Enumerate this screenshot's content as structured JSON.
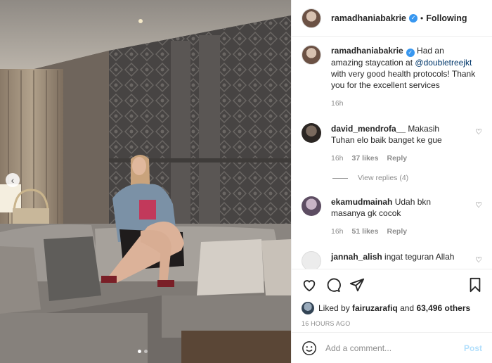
{
  "photo": {
    "alt_icon": "chevron-left-icon",
    "carousel_dots": 2,
    "active_dot": 0
  },
  "header": {
    "username": "ramadhaniabakrie",
    "separator": "•",
    "follow_status": "Following"
  },
  "caption": {
    "username": "ramadhaniabakrie",
    "text_before": " Had an amazing staycation at ",
    "mention": "@doubletreejkt",
    "text_after": " with very good health protocols! Thank you for the excellent services",
    "time": "16h"
  },
  "comments": [
    {
      "username": "david_mendrofa__",
      "text": " Makasih Tuhan elo baik banget ke gue",
      "time": "16h",
      "likes": "37 likes",
      "reply": "Reply",
      "avatar_color": "#3a3531"
    },
    {
      "username": "ekamudmainah",
      "text": " Udah bkn masanya gk cocok",
      "time": "16h",
      "likes": "51 likes",
      "reply": "Reply",
      "avatar_color": "#8a7a8f"
    },
    {
      "username": "jannah_alish",
      "text": " ingat teguran Allah",
      "avatar_color": "#ececec"
    }
  ],
  "view_replies": "View replies (4)",
  "likes": {
    "prefix": "Liked by ",
    "user": "fairuzarafiq",
    "middle": " and ",
    "count": "63,496 others"
  },
  "timestamp": "16 HOURS AGO",
  "add_comment": {
    "placeholder": "Add a comment...",
    "post_label": "Post"
  },
  "colors": {
    "verified": "#3897f0",
    "link": "#00376b",
    "post_disabled": "#b2dffc",
    "muted": "#8e8e8e"
  }
}
